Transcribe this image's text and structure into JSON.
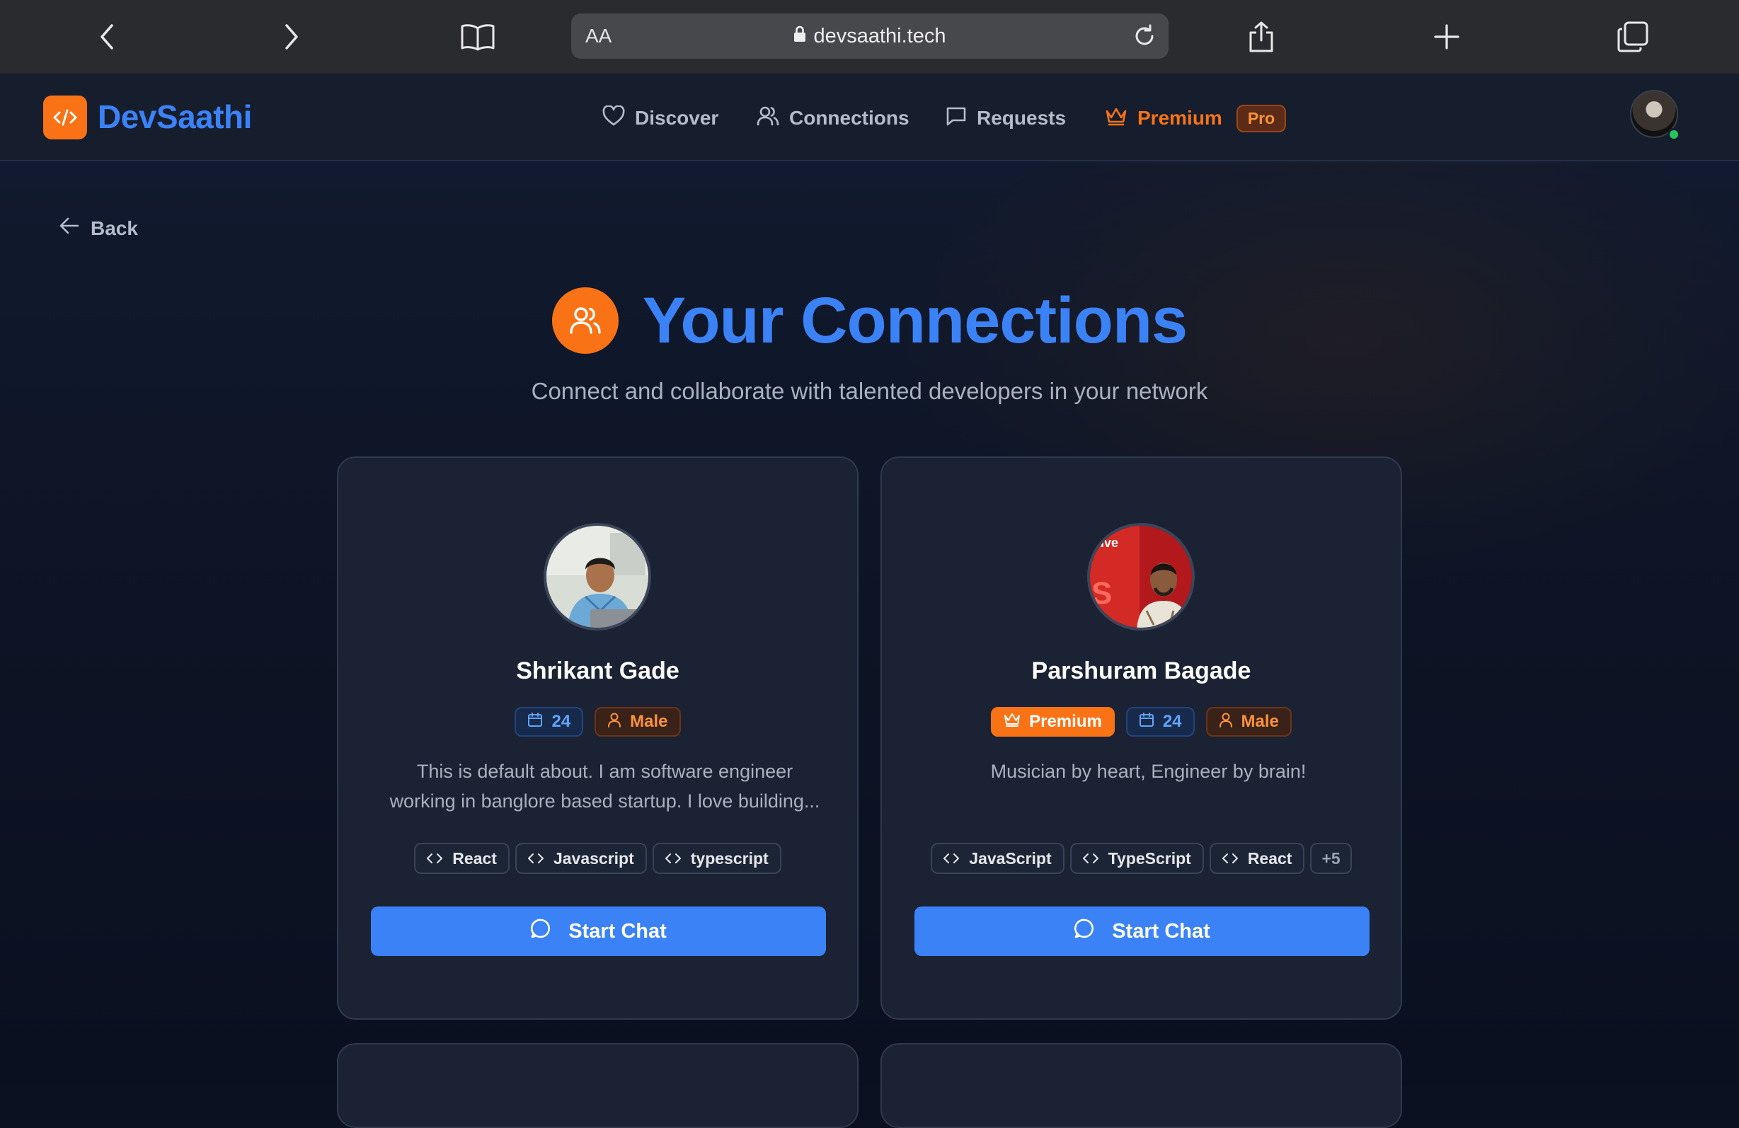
{
  "browser": {
    "url": "devsaathi.tech",
    "text_size_label": "AA"
  },
  "nav": {
    "brand": "DevSaathi",
    "links": [
      {
        "label": "Discover",
        "icon": "heart-icon"
      },
      {
        "label": "Connections",
        "icon": "users-icon"
      },
      {
        "label": "Requests",
        "icon": "message-square-icon"
      },
      {
        "label": "Premium",
        "icon": "crown-icon"
      }
    ],
    "pro_badge": "Pro"
  },
  "page": {
    "back_label": "Back",
    "title": "Your Connections",
    "subtitle": "Connect and collaborate with talented developers in your network"
  },
  "connections": [
    {
      "name": "Shrikant Gade",
      "premium": false,
      "age": "24",
      "gender": "Male",
      "about_lines": [
        "This is default about. I am software engineer",
        "working in banglore based startup. I love building..."
      ],
      "skills": [
        "React",
        "Javascript",
        "typescript"
      ],
      "more_skills": "",
      "chat_label": "Start Chat"
    },
    {
      "name": "Parshuram Bagade",
      "premium": true,
      "premium_label": "Premium",
      "age": "24",
      "gender": "Male",
      "about_lines": [
        "Musician by heart, Engineer by brain!"
      ],
      "skills": [
        "JavaScript",
        "TypeScript",
        "React"
      ],
      "more_skills": "+5",
      "chat_label": "Start Chat"
    }
  ],
  "colors": {
    "brand_blue": "#3b82f6",
    "accent_orange": "#f97316",
    "card_bg": "#1a2233",
    "online_green": "#22c55e"
  }
}
